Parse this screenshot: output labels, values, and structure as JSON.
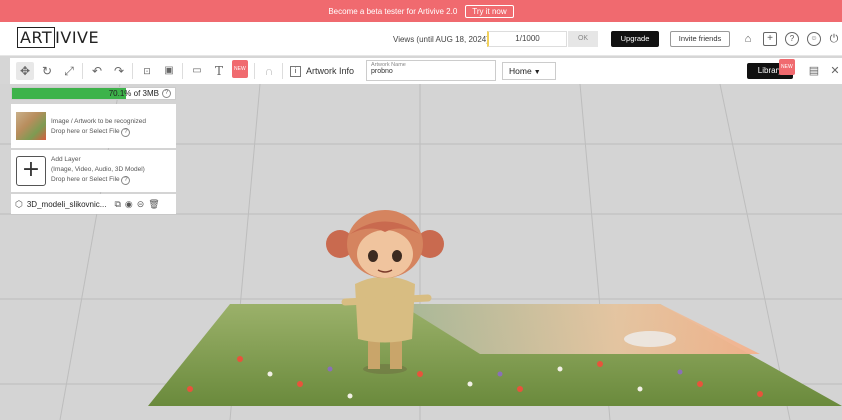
{
  "banner": {
    "text": "Become a beta tester for Artivive 2.0",
    "cta": "Try it now"
  },
  "header": {
    "logo_boxed": "ART",
    "logo_rest": "IVIVE",
    "views_label": "Views (until AUG 18, 2024)",
    "views_value": "1/1000",
    "ok_label": "OK",
    "upgrade_label": "Upgrade",
    "invite_label": "Invite friends",
    "icons": [
      "home-icon",
      "plus-square-icon",
      "help-icon",
      "account-icon",
      "power-icon"
    ]
  },
  "toolbar": {
    "tools": [
      "move-icon",
      "rotate-icon",
      "scale-icon",
      "undo-icon",
      "redo-icon",
      "crop-icon",
      "frame-icon",
      "folder-icon",
      "text-icon",
      "effects-icon",
      "magnet-icon"
    ],
    "new_badge": "NEW",
    "artwork_info_label": "Artwork Info",
    "name_label": "Artwork Name",
    "name_value": "probno",
    "home_select": "Home",
    "library_label": "Library",
    "library_badge": "NEW"
  },
  "storage": {
    "percent": "70.1%",
    "suffix": "of 3MB",
    "fill_fraction": 0.701
  },
  "panels": {
    "artwork": {
      "line1": "Image / Artwork to be recognized",
      "line2": "Drop here or Select File"
    },
    "add_layer": {
      "line1": "Add Layer",
      "line2": "(Image, Video, Audio, 3D Model)",
      "line3": "Drop here or Select File"
    },
    "layer": {
      "name": "3D_modeli_slikovnic..."
    }
  },
  "colors": {
    "banner": "#f06a6f",
    "progress": "#3db34a",
    "dark_button": "#111111"
  }
}
